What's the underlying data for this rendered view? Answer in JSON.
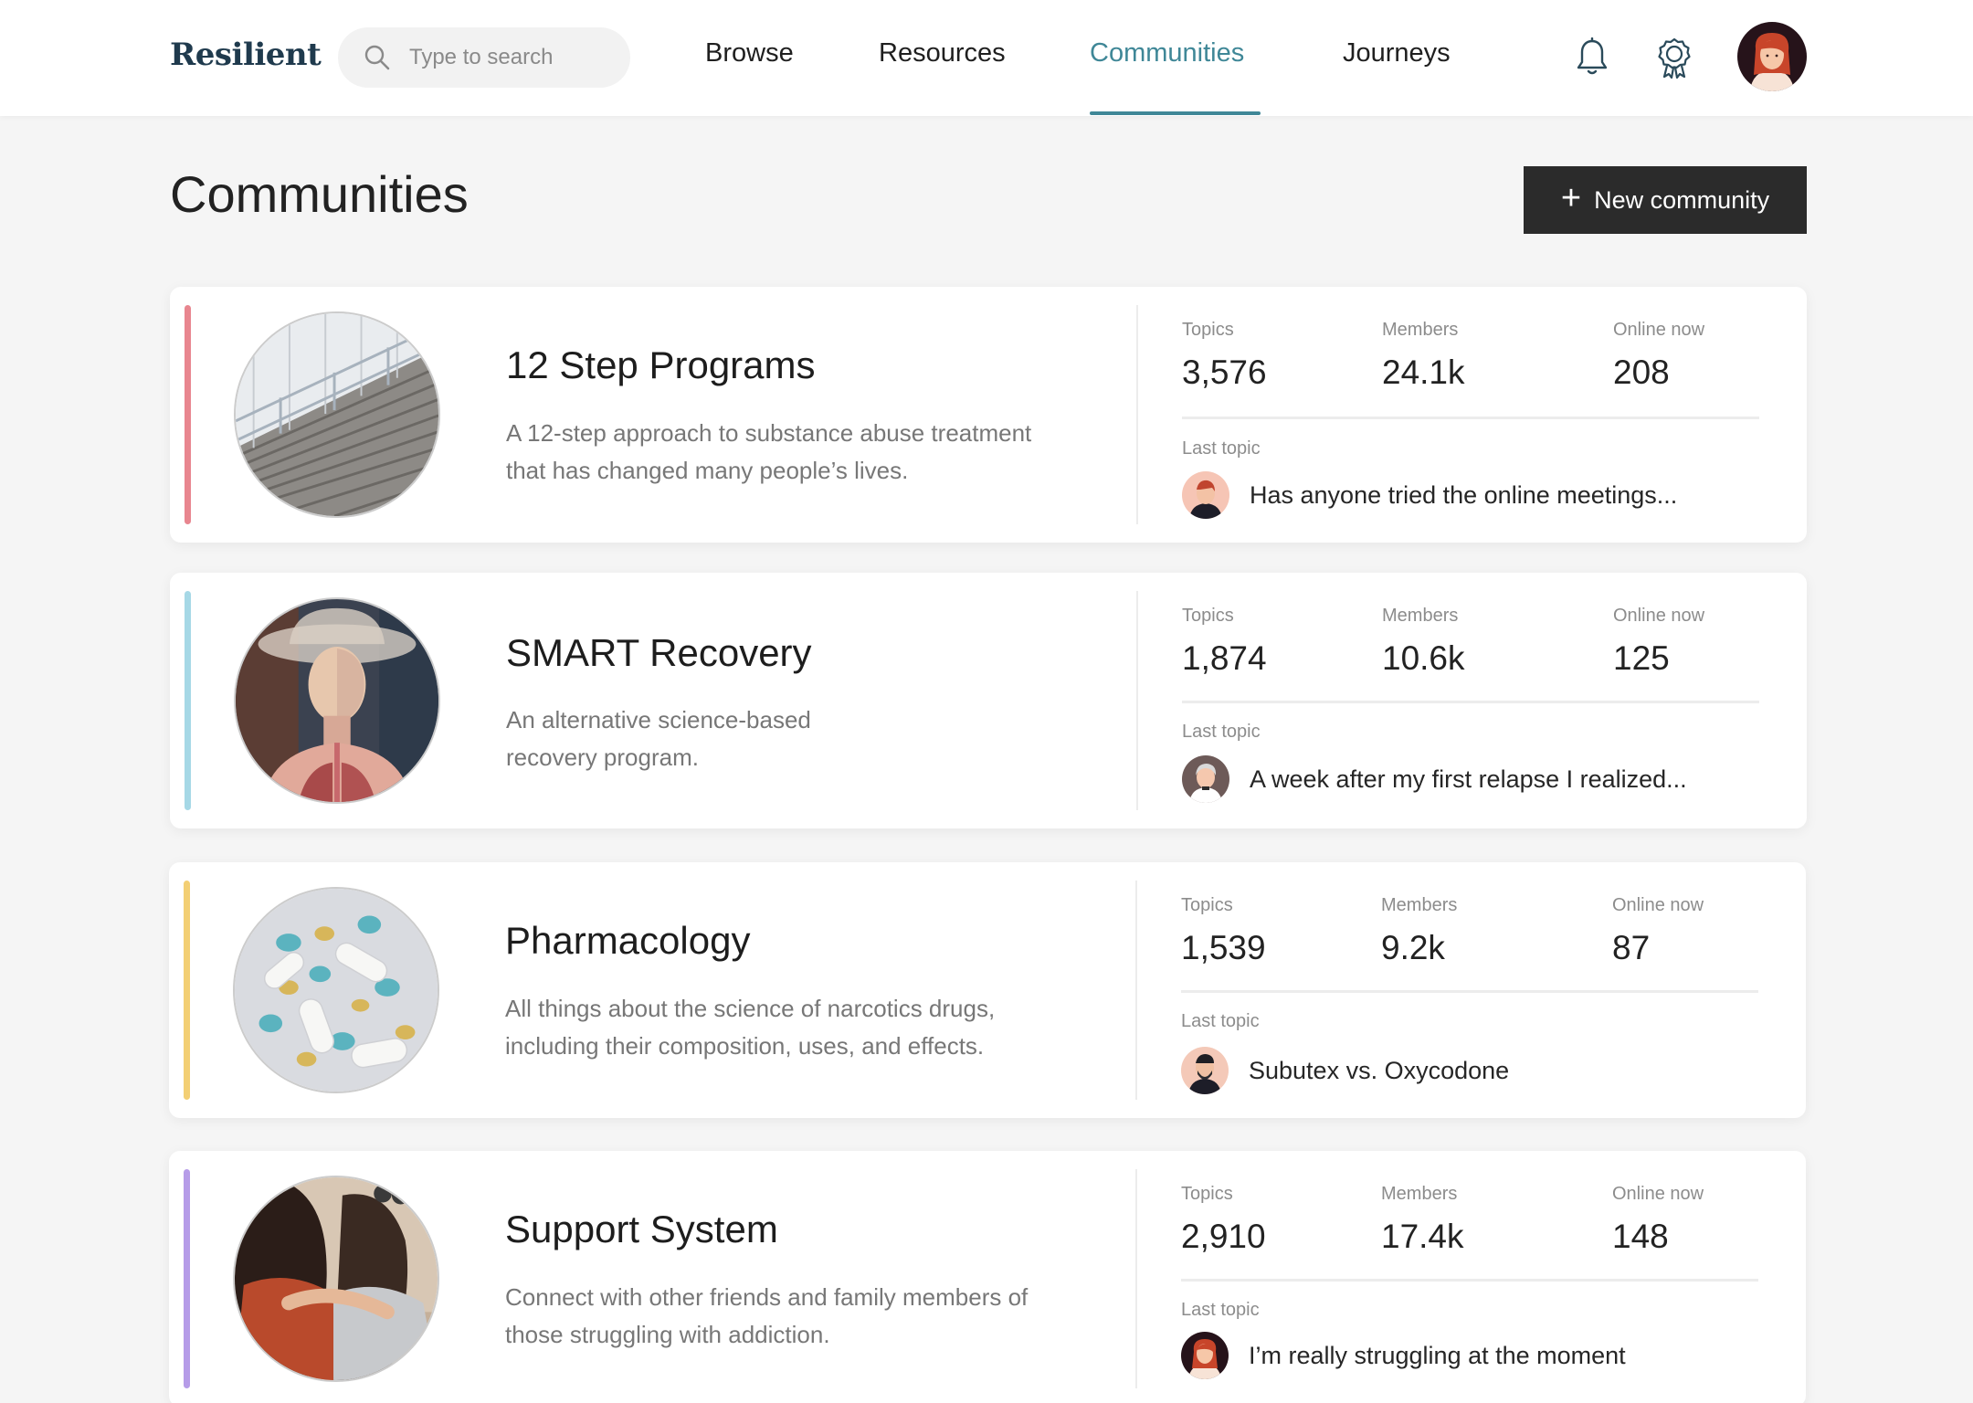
{
  "header": {
    "logo": "Resilient",
    "search_placeholder": "Type to search",
    "nav": [
      "Browse",
      "Resources",
      "Communities",
      "Journeys"
    ],
    "active_nav": "Communities",
    "accent_color": "#3f8797"
  },
  "page": {
    "title": "Communities",
    "new_button_label": "New community"
  },
  "stat_labels": {
    "topics": "Topics",
    "members": "Members",
    "online": "Online now",
    "last_topic": "Last topic"
  },
  "communities": [
    {
      "title": "12 Step Programs",
      "description": "A 12-step approach to substance abuse treatment that has changed many people’s lives.",
      "topics": "3,576",
      "members": "24.1k",
      "online": "208",
      "last_topic": "Has anyone tried the online meetings...",
      "accent": "#e8868f",
      "image": "stadium-stairs-image"
    },
    {
      "title": "SMART Recovery",
      "description": "An alternative science-based recovery program.",
      "topics": "1,874",
      "members": "10.6k",
      "online": "125",
      "last_topic": "A week after my first relapse I realized...",
      "accent": "#a6d8e6",
      "image": "anatomy-model-image"
    },
    {
      "title": "Pharmacology",
      "description": "All things about the science of narcotics drugs, including their composition, uses, and effects.",
      "topics": "1,539",
      "members": "9.2k",
      "online": "87",
      "last_topic": "Subutex vs. Oxycodone",
      "accent": "#f3cf74",
      "image": "pills-image"
    },
    {
      "title": "Support System",
      "description": "Connect with other friends and family members of those struggling with addiction.",
      "topics": "2,910",
      "members": "17.4k",
      "online": "148",
      "last_topic": "I’m really struggling at the moment",
      "accent": "#b69ce8",
      "image": "hugging-friends-image"
    }
  ]
}
